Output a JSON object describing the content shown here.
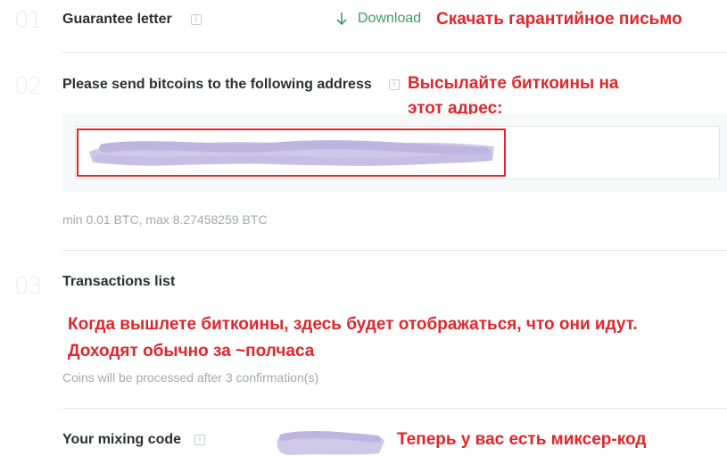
{
  "steps": [
    {
      "number": "01",
      "label": "Guarantee letter"
    },
    {
      "number": "02",
      "label": "Please send bitcoins to the following address"
    },
    {
      "number": "03",
      "label": "Transactions list"
    }
  ],
  "download": {
    "label": "Download"
  },
  "address": {
    "value": "",
    "limits": "min 0.01 BTC, max 8.27458259 BTC"
  },
  "transactions": {
    "note": "Coins will be processed after 3 confirmation(s)"
  },
  "mixing_code": {
    "label": "Your mixing code",
    "value": ""
  },
  "annotations": {
    "download_letter": "Скачать гарантийное письмо",
    "send_line1": "Высылайте биткоины на",
    "send_line2": "этот адрес:",
    "transactions_line1": "Когда вышлете биткоины, здесь будет отображаться, что они идут.",
    "transactions_line2": "Доходят обычно за ~полчаса",
    "mixing_code": "Теперь у вас есть миксер-код"
  },
  "colors": {
    "annotation_red": "#e0262b",
    "download_green": "#3f9b68",
    "redaction_lavender": "#c9c3e6"
  }
}
